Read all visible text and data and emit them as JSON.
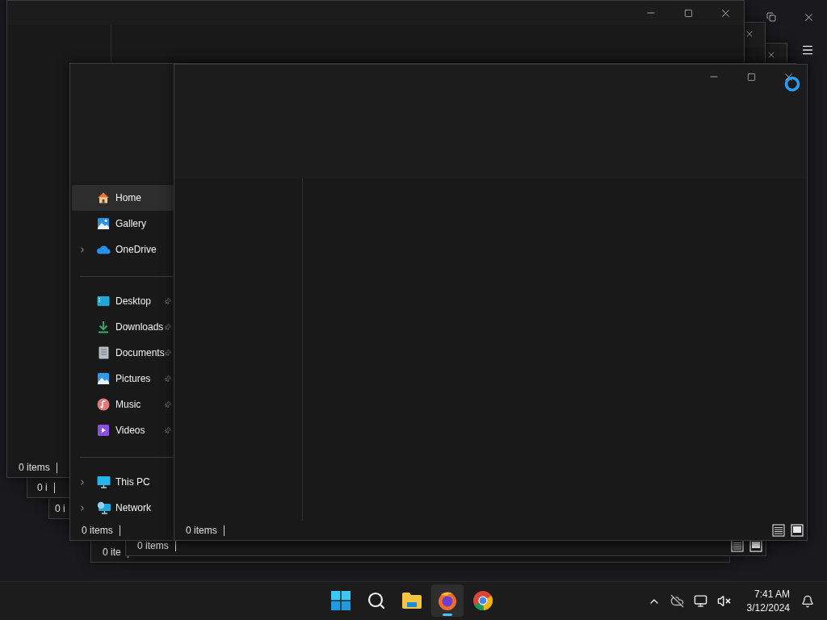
{
  "windows": [
    {
      "kind": "browser"
    },
    {
      "kind": "explorer",
      "status": "0 i"
    },
    {
      "kind": "explorer",
      "status": "0 i"
    },
    {
      "kind": "explorer",
      "status": "0 items"
    },
    {
      "kind": "explorer",
      "status": "0 ite"
    },
    {
      "kind": "explorer",
      "status": "0 items"
    },
    {
      "kind": "explorer",
      "status": "0 items",
      "sidebar": [
        [
          {
            "label": "Home",
            "selected": true,
            "expandable": false,
            "pinned": false
          },
          {
            "label": "Gallery",
            "selected": false,
            "expandable": false,
            "pinned": false
          },
          {
            "label": "OneDrive",
            "selected": false,
            "expandable": true,
            "pinned": false
          }
        ],
        [
          {
            "label": "Desktop",
            "selected": false,
            "expandable": false,
            "pinned": true
          },
          {
            "label": "Downloads",
            "selected": false,
            "expandable": false,
            "pinned": true
          },
          {
            "label": "Documents",
            "selected": false,
            "expandable": false,
            "pinned": true
          },
          {
            "label": "Pictures",
            "selected": false,
            "expandable": false,
            "pinned": true
          },
          {
            "label": "Music",
            "selected": false,
            "expandable": false,
            "pinned": true
          },
          {
            "label": "Videos",
            "selected": false,
            "expandable": false,
            "pinned": true
          }
        ],
        [
          {
            "label": "This PC",
            "selected": false,
            "expandable": true,
            "pinned": false
          },
          {
            "label": "Network",
            "selected": false,
            "expandable": true,
            "pinned": false
          }
        ]
      ]
    },
    {
      "kind": "explorer",
      "status": "0 items"
    }
  ],
  "busy_cursor": true,
  "taskbar": {
    "apps": [
      {
        "selected": false
      },
      {
        "selected": false
      },
      {
        "selected": false
      },
      {
        "selected": true
      },
      {
        "selected": false
      }
    ],
    "time": "7:41 AM",
    "date": "3/12/2024"
  }
}
